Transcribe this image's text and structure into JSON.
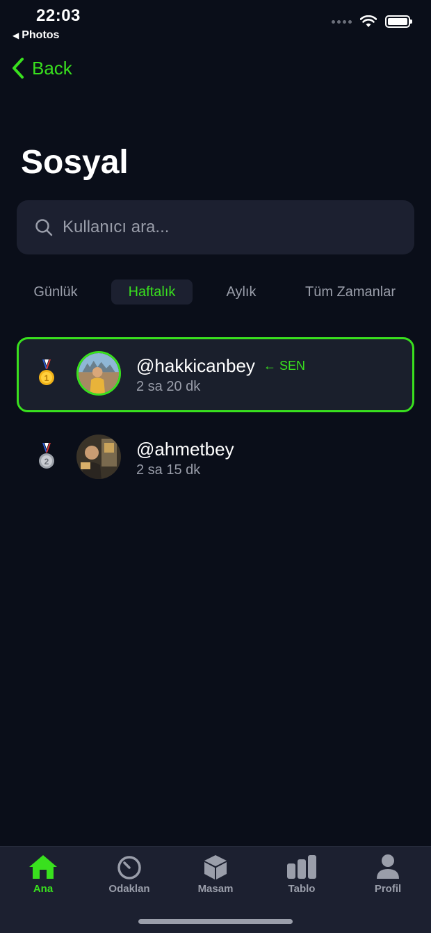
{
  "status_bar": {
    "time": "22:03",
    "back_app": "Photos"
  },
  "nav": {
    "back_label": "Back"
  },
  "page": {
    "title": "Sosyal"
  },
  "search": {
    "placeholder": "Kullanıcı ara..."
  },
  "tabs": [
    {
      "label": "Günlük",
      "active": false
    },
    {
      "label": "Haftalık",
      "active": true
    },
    {
      "label": "Aylık",
      "active": false
    },
    {
      "label": "Tüm Zamanlar",
      "active": false
    }
  ],
  "leaderboard": [
    {
      "rank": 1,
      "medal": "gold-medal-icon",
      "username": "@hakkicanbey",
      "tag": "← SEN",
      "time": "2 sa 20 dk",
      "is_me": true
    },
    {
      "rank": 2,
      "medal": "silver-medal-icon",
      "username": "@ahmetbey",
      "tag": "",
      "time": "2 sa 15 dk",
      "is_me": false
    }
  ],
  "tabbar": [
    {
      "label": "Ana",
      "icon": "home-icon",
      "active": true
    },
    {
      "label": "Odaklan",
      "icon": "timer-icon",
      "active": false
    },
    {
      "label": "Masam",
      "icon": "cube-icon",
      "active": false
    },
    {
      "label": "Tablo",
      "icon": "bar-chart-icon",
      "active": false
    },
    {
      "label": "Profil",
      "icon": "person-icon",
      "active": false
    }
  ],
  "colors": {
    "accent": "#39e01e",
    "background": "#0a0e19",
    "surface": "#1c2030",
    "muted_text": "#9a9eaa"
  }
}
